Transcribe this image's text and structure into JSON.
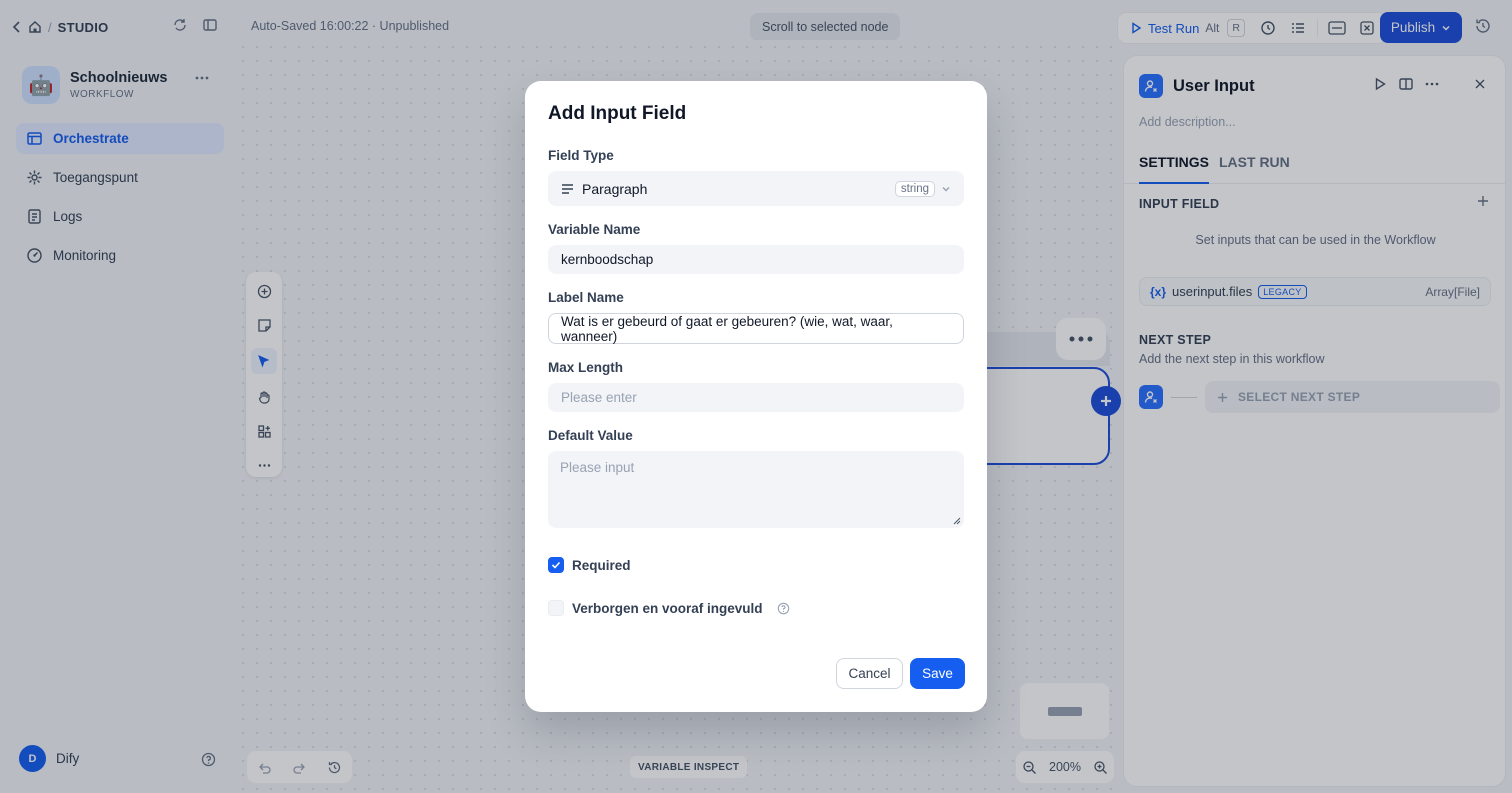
{
  "topbar": {
    "studio_label": "STUDIO",
    "separator": "/",
    "autosave": "Auto-Saved 16:00:22 · Unpublished",
    "scroll_to_node": "Scroll to selected node",
    "test_run": "Test Run",
    "test_run_kbd_1": "Alt",
    "test_run_kbd_2": "R",
    "publish": "Publish"
  },
  "sidebar": {
    "app_name": "Schoolnieuws",
    "app_type": "WORKFLOW",
    "app_emoji": "🤖",
    "items": [
      {
        "label": "Orchestrate",
        "icon": "layout-icon",
        "active": true
      },
      {
        "label": "Toegangspunt",
        "icon": "api-icon",
        "active": false
      },
      {
        "label": "Logs",
        "icon": "document-icon",
        "active": false
      },
      {
        "label": "Monitoring",
        "icon": "gauge-icon",
        "active": false
      }
    ],
    "user_initial": "D",
    "user_name": "Dify"
  },
  "canvas": {
    "variable_inspect": "VARIABLE INSPECT",
    "zoom_level": "200%"
  },
  "panel": {
    "title": "User Input",
    "description_placeholder": "Add description...",
    "tabs": [
      {
        "label": "SETTINGS",
        "active": true
      },
      {
        "label": "LAST RUN",
        "active": false
      }
    ],
    "input_field_heading": "INPUT FIELD",
    "input_field_hint": "Set inputs that can be used in the Workflow",
    "variable": {
      "prefix": "{x}",
      "name": "userinput.files",
      "badge": "LEGACY",
      "type": "Array[File]"
    },
    "next_step_heading": "NEXT STEP",
    "next_step_hint": "Add the next step in this workflow",
    "select_next_step": "SELECT NEXT STEP"
  },
  "modal": {
    "title": "Add Input Field",
    "field_type_label": "Field Type",
    "field_type_value": "Paragraph",
    "field_type_badge": "string",
    "variable_name_label": "Variable Name",
    "variable_name_value": "kernboodschap",
    "label_name_label": "Label Name",
    "label_name_value": "Wat is er gebeurd of gaat er gebeuren? (wie, wat, waar, wanneer)",
    "max_length_label": "Max Length",
    "max_length_placeholder": "Please enter",
    "default_value_label": "Default Value",
    "default_value_placeholder": "Please input",
    "required_label": "Required",
    "required_checked": true,
    "hidden_label": "Verborgen en vooraf ingevuld",
    "hidden_checked": false,
    "cancel": "Cancel",
    "save": "Save"
  },
  "colors": {
    "accent": "#155eef",
    "publish": "#1d4ed8",
    "active_nav_bg": "#e0eaff"
  }
}
